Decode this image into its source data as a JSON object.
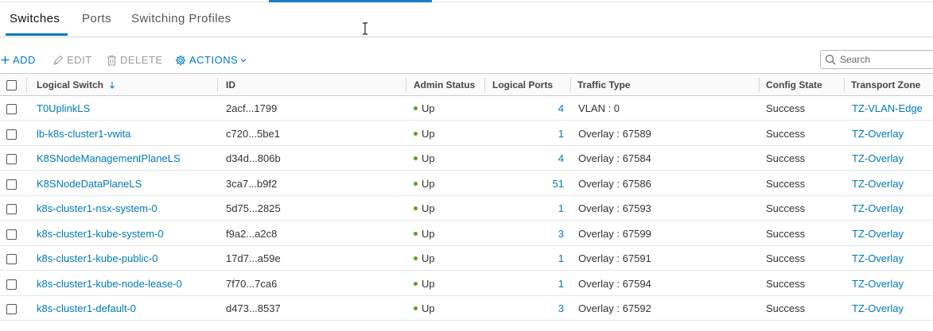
{
  "tabs": [
    {
      "label": "Switches"
    },
    {
      "label": "Ports"
    },
    {
      "label": "Switching Profiles"
    }
  ],
  "toolbar": {
    "add_label": "ADD",
    "edit_label": "EDIT",
    "delete_label": "DELETE",
    "actions_label": "ACTIONS"
  },
  "search": {
    "placeholder": "Search"
  },
  "columns": {
    "logical_switch": "Logical Switch",
    "id": "ID",
    "admin_status": "Admin Status",
    "logical_ports": "Logical Ports",
    "traffic_type": "Traffic Type",
    "config_state": "Config State",
    "transport_zone": "Transport Zone"
  },
  "rows": [
    {
      "name": "T0UplinkLS",
      "id": "2acf...1799",
      "admin_status": "Up",
      "ports": "4",
      "traffic": "VLAN : 0",
      "config_state": "Success",
      "zone": "TZ-VLAN-Edge"
    },
    {
      "name": "lb-k8s-cluster1-vwita",
      "id": "c720...5be1",
      "admin_status": "Up",
      "ports": "1",
      "traffic": "Overlay : 67589",
      "config_state": "Success",
      "zone": "TZ-Overlay"
    },
    {
      "name": "K8SNodeManagementPlaneLS",
      "id": "d34d...806b",
      "admin_status": "Up",
      "ports": "4",
      "traffic": "Overlay : 67584",
      "config_state": "Success",
      "zone": "TZ-Overlay"
    },
    {
      "name": "K8SNodeDataPlaneLS",
      "id": "3ca7...b9f2",
      "admin_status": "Up",
      "ports": "51",
      "traffic": "Overlay : 67586",
      "config_state": "Success",
      "zone": "TZ-Overlay"
    },
    {
      "name": "k8s-cluster1-nsx-system-0",
      "id": "5d75...2825",
      "admin_status": "Up",
      "ports": "1",
      "traffic": "Overlay : 67593",
      "config_state": "Success",
      "zone": "TZ-Overlay"
    },
    {
      "name": "k8s-cluster1-kube-system-0",
      "id": "f9a2...a2c8",
      "admin_status": "Up",
      "ports": "3",
      "traffic": "Overlay : 67599",
      "config_state": "Success",
      "zone": "TZ-Overlay"
    },
    {
      "name": "k8s-cluster1-kube-public-0",
      "id": "17d7...a59e",
      "admin_status": "Up",
      "ports": "1",
      "traffic": "Overlay : 67591",
      "config_state": "Success",
      "zone": "TZ-Overlay"
    },
    {
      "name": "k8s-cluster1-kube-node-lease-0",
      "id": "7f70...7ca6",
      "admin_status": "Up",
      "ports": "1",
      "traffic": "Overlay : 67594",
      "config_state": "Success",
      "zone": "TZ-Overlay"
    },
    {
      "name": "k8s-cluster1-default-0",
      "id": "d473...8537",
      "admin_status": "Up",
      "ports": "3",
      "traffic": "Overlay : 67592",
      "config_state": "Success",
      "zone": "TZ-Overlay"
    }
  ]
}
